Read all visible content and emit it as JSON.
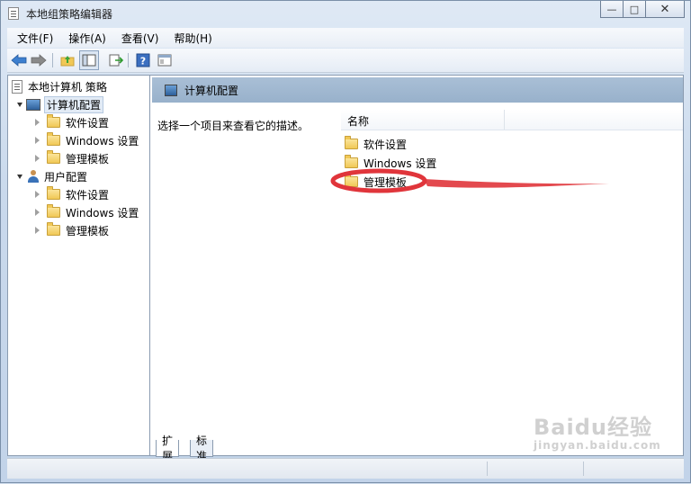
{
  "window": {
    "title": "本地组策略编辑器",
    "buttons": {
      "minimize": "—",
      "maximize": "□",
      "close": "✕"
    }
  },
  "menu": [
    "文件(F)",
    "操作(A)",
    "查看(V)",
    "帮助(H)"
  ],
  "toolbar": {
    "icons": [
      "back-arrow-icon",
      "forward-arrow-icon",
      "up-folder-icon",
      "show-hide-tree-icon",
      "export-list-icon",
      "help-icon",
      "properties-icon"
    ],
    "help_glyph": "?"
  },
  "tree": {
    "root": "本地计算机 策略",
    "computer": {
      "label": "计算机配置",
      "children": [
        "软件设置",
        "Windows 设置",
        "管理模板"
      ]
    },
    "user": {
      "label": "用户配置",
      "children": [
        "软件设置",
        "Windows 设置",
        "管理模板"
      ]
    }
  },
  "right_pane": {
    "header": "计算机配置",
    "description": "选择一个项目来查看它的描述。",
    "column": "名称",
    "items": [
      "软件设置",
      "Windows 设置",
      "管理模板"
    ]
  },
  "tabs": [
    "扩展",
    "标准"
  ],
  "watermark": {
    "main": "Baidu经验",
    "sub": "jingyan.baidu.com"
  },
  "colors": {
    "annotation": "#e0353b",
    "header_bg": "#a9bfd6",
    "folder": "#f1c856"
  }
}
